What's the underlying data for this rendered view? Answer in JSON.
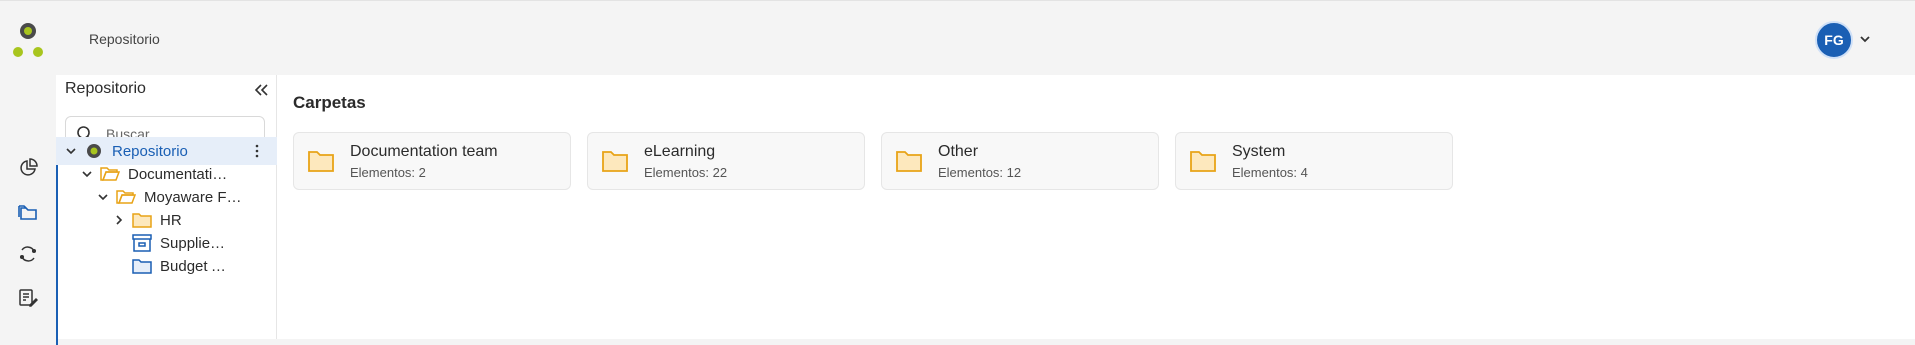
{
  "header": {
    "breadcrumb": "Repositorio",
    "avatar_initials": "FG"
  },
  "rail": {
    "icons": [
      "dashboard-icon",
      "folders-icon",
      "sync-icon",
      "tasks-icon"
    ],
    "active": "folders-icon"
  },
  "sidebar": {
    "title": "Repositorio",
    "search_placeholder": "Buscar",
    "tree": [
      {
        "label": "Repositorio",
        "icon": "repository-icon",
        "expanded": true,
        "selected": true
      },
      {
        "label": "Documentation team",
        "icon": "folder-open-icon",
        "expanded": true
      },
      {
        "label": "Moyaware Foundation",
        "icon": "folder-open-icon",
        "expanded": true
      },
      {
        "label": "HR",
        "icon": "folder-icon",
        "expanded": false
      },
      {
        "label": "Supplier Invoices",
        "icon": "archive-icon"
      },
      {
        "label": "Budget Approvals",
        "icon": "folder-blue-icon"
      }
    ]
  },
  "main": {
    "section_title": "Carpetas",
    "cards": [
      {
        "name": "Documentation team",
        "count": "Elementos: 2"
      },
      {
        "name": "eLearning",
        "count": "Elementos: 22"
      },
      {
        "name": "Other",
        "count": "Elementos: 12"
      },
      {
        "name": "System",
        "count": "Elementos: 4"
      }
    ]
  },
  "colors": {
    "accent": "#1a5fb4",
    "folder": "#e8a317",
    "folder_fill": "#fde8bd",
    "logo_dark": "#4a4a4a",
    "logo_green": "#a8c51e"
  }
}
